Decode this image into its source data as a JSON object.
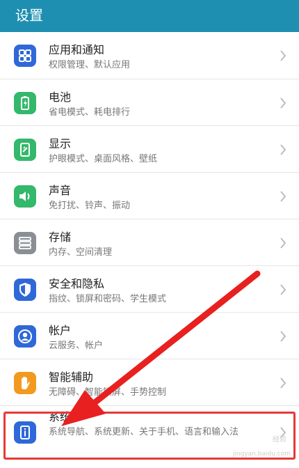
{
  "header": {
    "title": "设置"
  },
  "items": [
    {
      "title": "应用和通知",
      "subtitle": "权限管理、默认应用",
      "icon": "apps-icon",
      "color": "#2f68d8"
    },
    {
      "title": "电池",
      "subtitle": "省电模式、耗电排行",
      "icon": "battery-icon",
      "color": "#34b86b"
    },
    {
      "title": "显示",
      "subtitle": "护眼模式、桌面风格、壁纸",
      "icon": "display-icon",
      "color": "#34b86b"
    },
    {
      "title": "声音",
      "subtitle": "免打扰、铃声、振动",
      "icon": "sound-icon",
      "color": "#34b86b"
    },
    {
      "title": "存储",
      "subtitle": "内存、空间清理",
      "icon": "storage-icon",
      "color": "#8a8f96"
    },
    {
      "title": "安全和隐私",
      "subtitle": "指纹、锁屏和密码、学生模式",
      "icon": "shield-icon",
      "color": "#2f68d8"
    },
    {
      "title": "帐户",
      "subtitle": "云服务、帐户",
      "icon": "account-icon",
      "color": "#2f68d8"
    },
    {
      "title": "智能辅助",
      "subtitle": "无障碍、智能锁屏、手势控制",
      "icon": "hand-icon",
      "color": "#f29a1f"
    },
    {
      "title": "系统",
      "subtitle": "系统导航、系统更新、关于手机、语言和输入法",
      "icon": "system-info-icon",
      "color": "#2f68d8"
    }
  ],
  "watermark": {
    "line1": "经验",
    "line2": "jingyan.baidu.com"
  },
  "colors": {
    "header": "#1e8fb0",
    "highlight": "#e53935"
  }
}
